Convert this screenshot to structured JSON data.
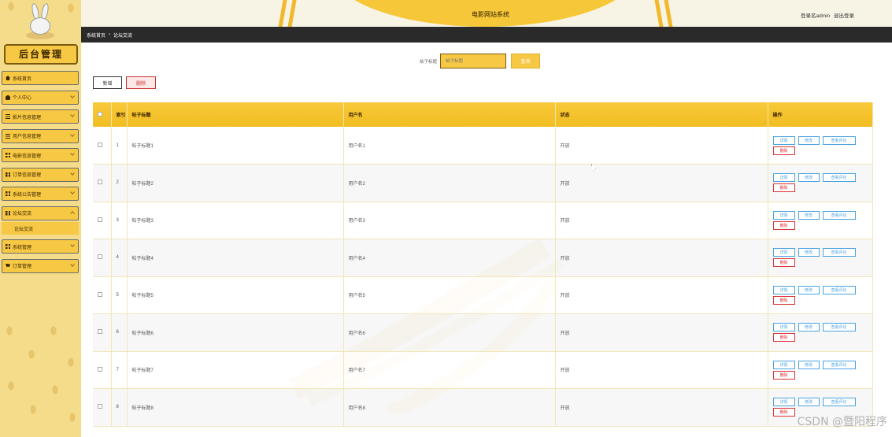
{
  "header": {
    "system_title": "电影网站系统",
    "user_prefix": "登录名admin",
    "logout_label": "退出登录"
  },
  "sidebar": {
    "admin_title": "后台管理",
    "items": [
      {
        "label": "系统首页",
        "icon": "home-icon"
      },
      {
        "label": "个人中心",
        "icon": "user-icon"
      },
      {
        "label": "影片信息管理",
        "icon": "list-icon"
      },
      {
        "label": "用户信息管理",
        "icon": "list-icon"
      },
      {
        "label": "电影信息管理",
        "icon": "grid-icon"
      },
      {
        "label": "订单信息管理",
        "icon": "grid-icon"
      },
      {
        "label": "系统公告管理",
        "icon": "grid-icon"
      },
      {
        "label": "论坛交流",
        "icon": "grid-icon"
      },
      {
        "label": "系统管理",
        "icon": "grid-icon"
      },
      {
        "label": "订单管理",
        "icon": "cart-icon"
      }
    ],
    "submenu_label": "论坛交流"
  },
  "breadcrumb": {
    "home": "系统首页",
    "separator": "›",
    "current": "论坛交流"
  },
  "search": {
    "label": "帖子标题",
    "placeholder": "帖子标题",
    "button": "查询"
  },
  "actions": {
    "add": "新增",
    "delete": "删除"
  },
  "table": {
    "headers": [
      "",
      "索引",
      "帖子标题",
      "用户名",
      "状态",
      "操作"
    ],
    "rows": [
      {
        "index": "1",
        "title": "帖子标题1",
        "user": "用户名1",
        "status": "开放"
      },
      {
        "index": "2",
        "title": "帖子标题2",
        "user": "用户名2",
        "status": "开放"
      },
      {
        "index": "3",
        "title": "帖子标题3",
        "user": "用户名3",
        "status": "开放"
      },
      {
        "index": "4",
        "title": "帖子标题4",
        "user": "用户名4",
        "status": "开放"
      },
      {
        "index": "5",
        "title": "帖子标题5",
        "user": "用户名5",
        "status": "开放"
      },
      {
        "index": "6",
        "title": "帖子标题6",
        "user": "用户名6",
        "status": "开放"
      },
      {
        "index": "7",
        "title": "帖子标题7",
        "user": "用户名7",
        "status": "开放"
      },
      {
        "index": "8",
        "title": "帖子标题8",
        "user": "用户名8",
        "status": "开放"
      }
    ],
    "row_actions": {
      "detail": "详情",
      "edit": "修改",
      "review": "查看评论",
      "delete": "删除"
    }
  },
  "watermark": "CSDN @暨阳程序",
  "colors": {
    "accent": "#f7c843",
    "dark_bar": "#2a2a2a",
    "sidebar_bg": "#f5dc8a",
    "link_blue": "#4aa3e0",
    "danger_red": "#d33333"
  }
}
